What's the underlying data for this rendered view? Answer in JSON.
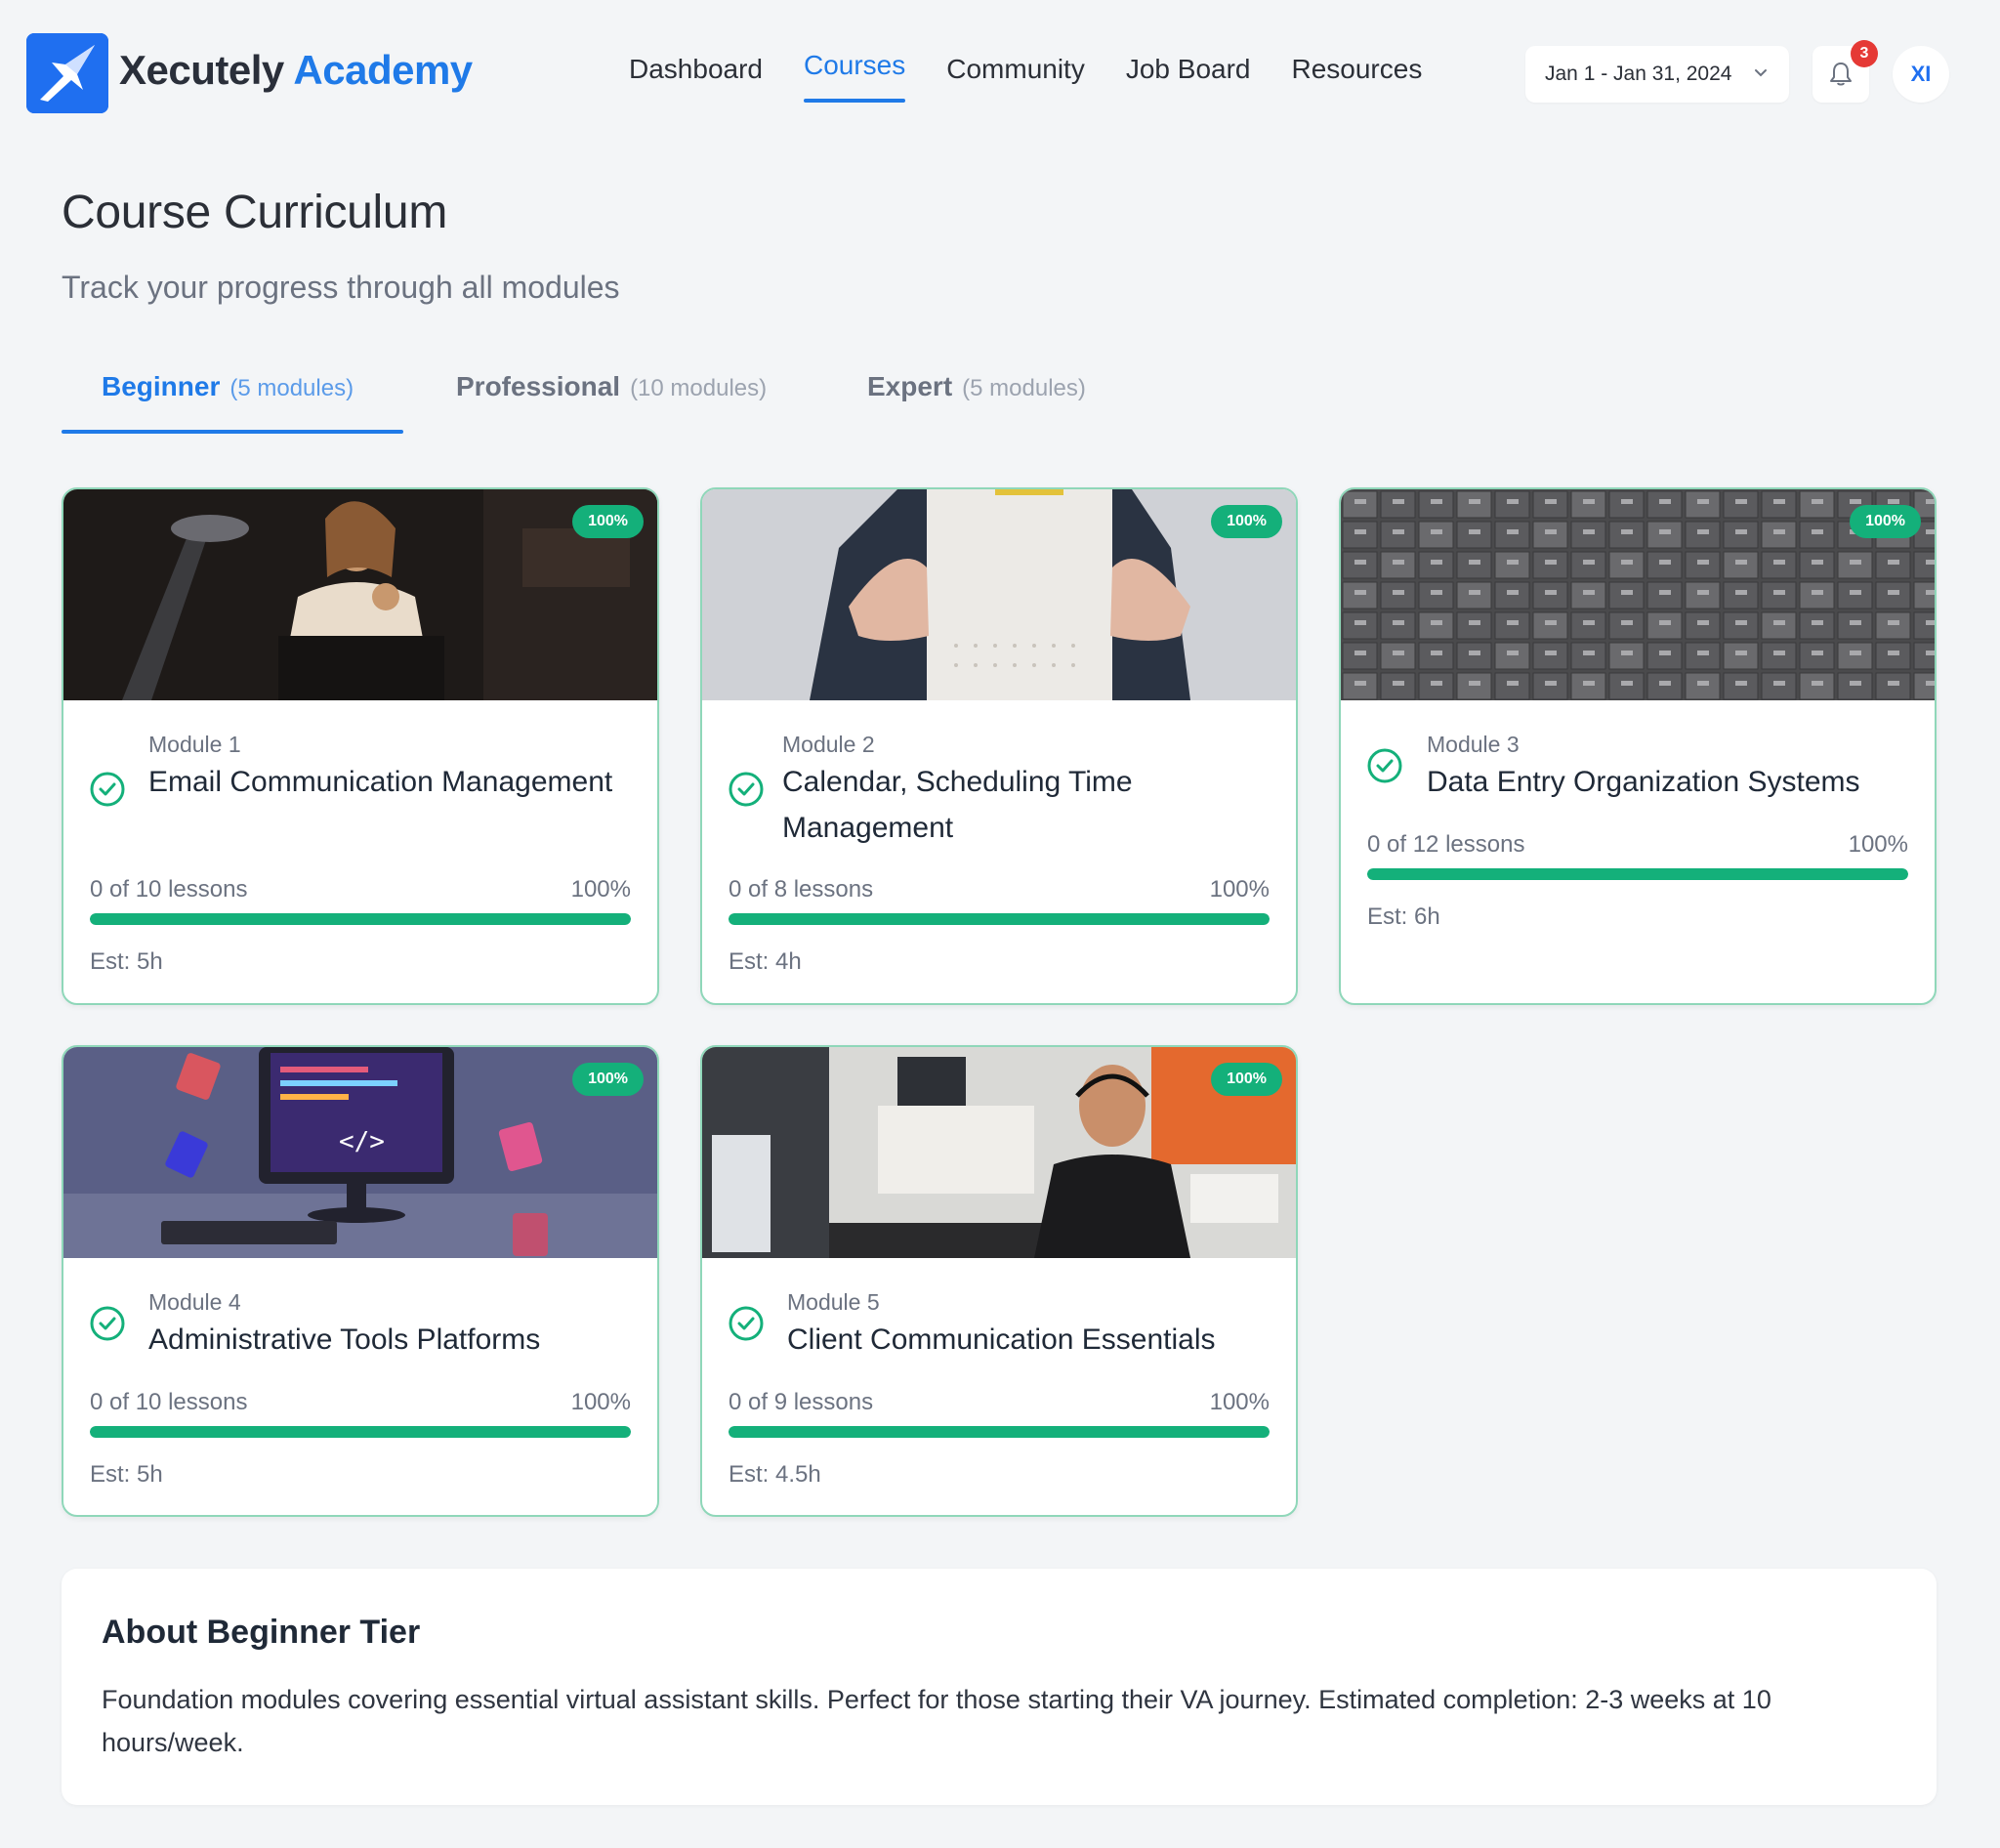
{
  "brand": {
    "name_part1": "Xecutely",
    "name_part2": "Academy",
    "color": "#1f7ae8"
  },
  "nav": {
    "dashboard": "Dashboard",
    "courses": "Courses",
    "community": "Community",
    "job_board": "Job Board",
    "resources": "Resources"
  },
  "header": {
    "date_range": "Jan 1 - Jan 31, 2024",
    "notification_count": "3",
    "avatar_initials": "XI"
  },
  "page": {
    "title": "Course Curriculum",
    "subtitle": "Track your progress through all modules"
  },
  "tabs": [
    {
      "label": "Beginner",
      "count": "(5 modules)",
      "active": true
    },
    {
      "label": "Professional",
      "count": "(10 modules)",
      "active": false
    },
    {
      "label": "Expert",
      "count": "(5 modules)",
      "active": false
    }
  ],
  "modules": [
    {
      "number": "Module 1",
      "title": "Email Communication Management",
      "lessons": "0 of 10 lessons",
      "percent": "100%",
      "progress": 1.0,
      "estimate": "Est: 5h",
      "badge": "100%",
      "image_icon": "woman-at-laptop-night-photo"
    },
    {
      "number": "Module 2",
      "title": "Calendar, Scheduling Time Management",
      "lessons": "0 of 8 lessons",
      "percent": "100%",
      "progress": 1.0,
      "estimate": "Est: 4h",
      "badge": "100%",
      "image_icon": "calendar-page-photo"
    },
    {
      "number": "Module 3",
      "title": "Data Entry Organization Systems",
      "lessons": "0 of 12 lessons",
      "percent": "100%",
      "progress": 1.0,
      "estimate": "Est: 6h",
      "badge": "100%",
      "image_icon": "filing-cabinets-photo"
    },
    {
      "number": "Module 4",
      "title": "Administrative Tools Platforms",
      "lessons": "0 of 10 lessons",
      "percent": "100%",
      "progress": 1.0,
      "estimate": "Est: 5h",
      "badge": "100%",
      "image_icon": "computer-code-illustration"
    },
    {
      "number": "Module 5",
      "title": "Client Communication Essentials",
      "lessons": "0 of 9 lessons",
      "percent": "100%",
      "progress": 1.0,
      "estimate": "Est: 4.5h",
      "badge": "100%",
      "image_icon": "call-center-agent-photo"
    }
  ],
  "about": {
    "title": "About Beginner Tier",
    "text": "Foundation modules covering essential virtual assistant skills. Perfect for those starting their VA journey. Estimated completion: 2-3 weeks at 10 hours/week."
  },
  "colors": {
    "accent": "#1f7ae8",
    "success": "#14b07a",
    "card_border": "#8fd7b9",
    "badge": "#e53935"
  }
}
